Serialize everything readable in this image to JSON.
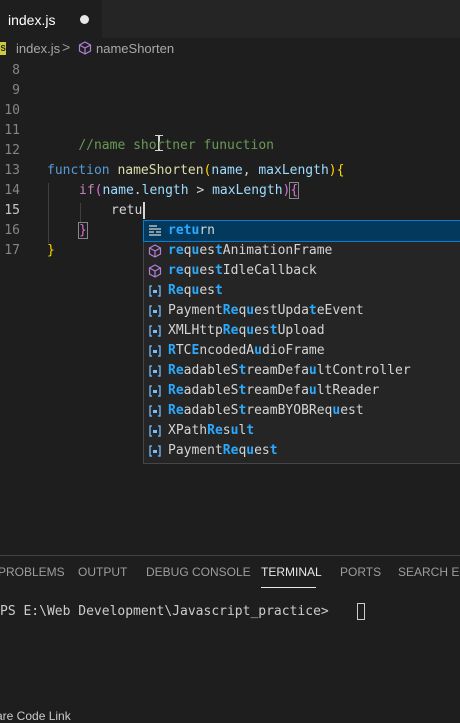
{
  "tab": {
    "label": "index.js",
    "dirty": true
  },
  "breadcrumb": {
    "file": "index.js",
    "separator": ">",
    "symbol": "nameShorten"
  },
  "editor": {
    "line_numbers": [
      "8",
      "9",
      "10",
      "11",
      "12",
      "13",
      "14",
      "15",
      "16",
      "17"
    ],
    "active_line": "15",
    "lines": {
      "l11": "//name shortner funuction",
      "l13_kw": "function",
      "l13_fn": "nameShorten",
      "l13_open": "(",
      "l13_p1": "name",
      "l13_comma": ", ",
      "l13_p2": "maxLength",
      "l13_close": ")",
      "l13_brace": "{",
      "l14_kw": "if",
      "l14_open": "(",
      "l14_p1": "name",
      "l14_dot": ".",
      "l14_prop": "length",
      "l14_op": " > ",
      "l14_p2": "maxLength",
      "l14_close": ")",
      "l14_brace": "{",
      "l15_typed": "retu",
      "l16_brace": "}",
      "l17_brace": "}"
    }
  },
  "suggestions": [
    {
      "icon": "keyword-snippet-icon",
      "match": "retu",
      "rest": "rn",
      "selected": true
    },
    {
      "icon": "method-cube-icon",
      "pre": "",
      "label": "requestAnimationFrame"
    },
    {
      "icon": "method-cube-icon",
      "pre": "",
      "label": "requestIdleCallback"
    },
    {
      "icon": "variable-bracket-icon",
      "pre": "",
      "label": "Request"
    },
    {
      "icon": "variable-bracket-icon",
      "pre": "Payment",
      "label": "PaymentRequestUpdateEvent"
    },
    {
      "icon": "variable-bracket-icon",
      "pre": "XMLHttp",
      "label": "XMLHttpRequestUpload"
    },
    {
      "icon": "variable-bracket-icon",
      "pre": "RTC",
      "label": "RTCEncodedAudioFrame"
    },
    {
      "icon": "variable-bracket-icon",
      "pre": "",
      "label": "ReadableStreamDefaultController"
    },
    {
      "icon": "variable-bracket-icon",
      "pre": "",
      "label": "ReadableStreamDefaultReader"
    },
    {
      "icon": "variable-bracket-icon",
      "pre": "",
      "label": "ReadableStreamBYOBRequest"
    },
    {
      "icon": "variable-bracket-icon",
      "pre": "XPath",
      "label": "XPathResult"
    },
    {
      "icon": "variable-bracket-icon",
      "pre": "Payment",
      "label": "PaymentRequest"
    }
  ],
  "panel": {
    "tabs": [
      "PROBLEMS",
      "OUTPUT",
      "DEBUG CONSOLE",
      "TERMINAL",
      "PORTS",
      "SEARCH ERR"
    ],
    "active_tab": "TERMINAL",
    "terminal_prompt": "PS E:\\Web Development\\Javascript_practice> "
  },
  "statusbar": {
    "text": "are Code Link"
  },
  "colors": {
    "editor_bg": "#1e1e1e",
    "keyword": "#569cd6",
    "function": "#dcdcaa",
    "param": "#9cdcfe",
    "comment": "#6a9955",
    "match_highlight": "#2aaaff",
    "selection": "#04395e"
  }
}
